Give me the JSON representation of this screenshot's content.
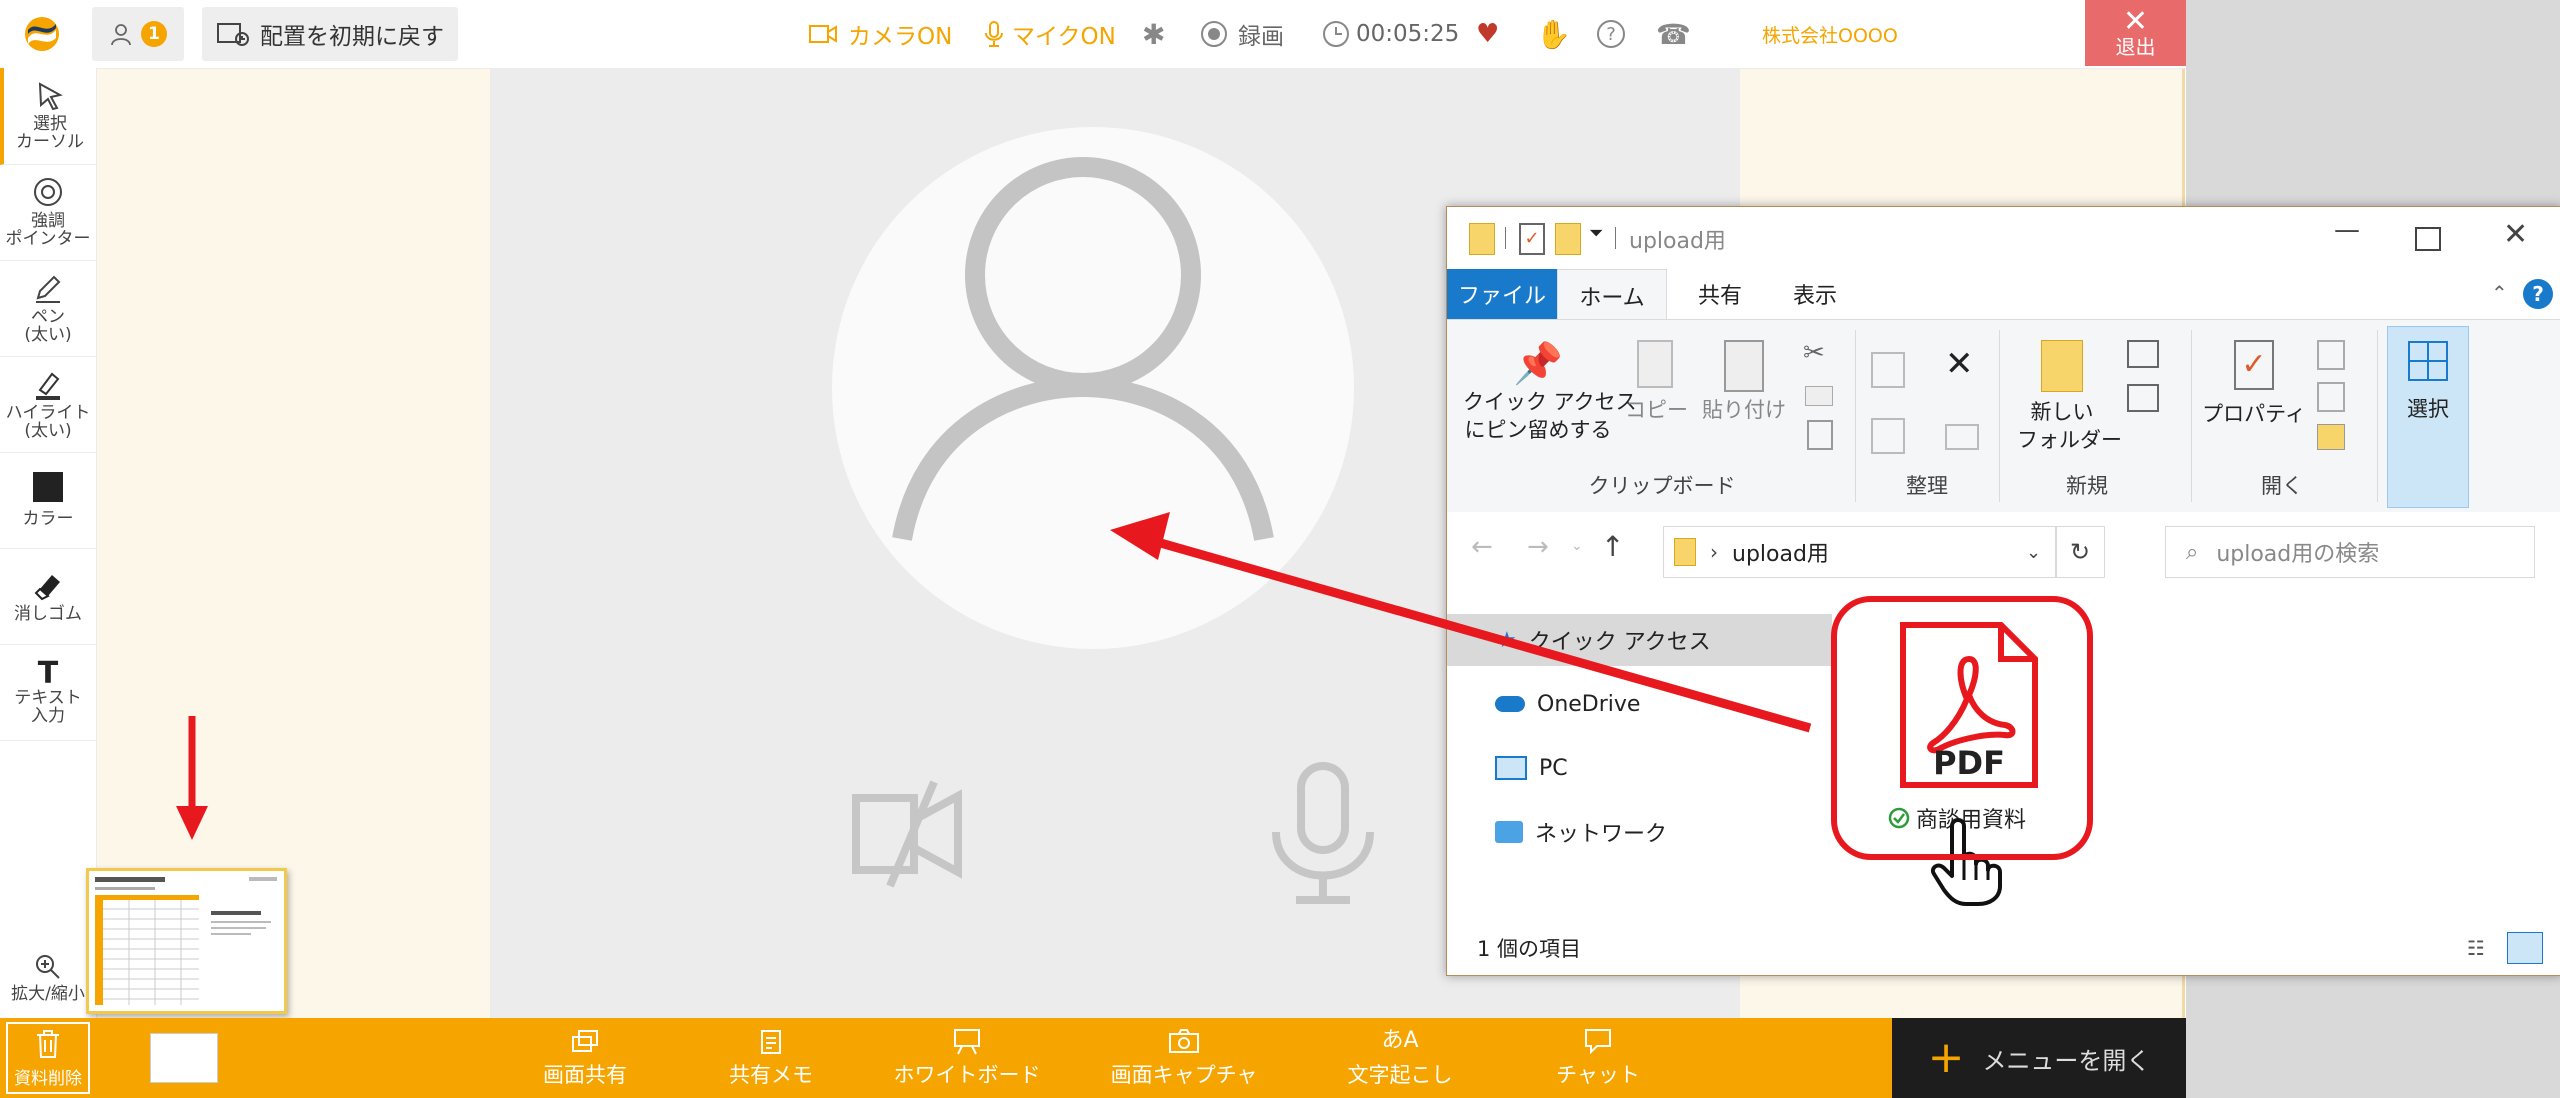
{
  "topbar": {
    "participant_count": "1",
    "reset_layout_label": "配置を初期に戻す",
    "camera_label": "カメラON",
    "mic_label": "マイクON",
    "record_label": "録画",
    "elapsed_time": "00:05:25",
    "company_name": "株式会社OOOO",
    "exit_label": "退出"
  },
  "left_tools": {
    "select_line1": "選択",
    "select_line2": "カーソル",
    "pointer_line1": "強調",
    "pointer_line2": "ポインター",
    "pen_line1": "ペン",
    "pen_line2": "(太い)",
    "highlight_line1": "ハイライト",
    "highlight_line2": "(太い)",
    "color_label": "カラー",
    "eraser_label": "消しゴム",
    "text_line1": "テキスト",
    "text_line2": "入力",
    "zoom_label": "拡大/縮小"
  },
  "bottombar": {
    "delete_label": "資料削除",
    "screen_share": "画面共有",
    "shared_memo": "共有メモ",
    "whiteboard": "ホワイトボード",
    "screen_capture": "画面キャプチャ",
    "transcription": "文字起こし",
    "chat": "チャット",
    "open_menu": "メニューを開く"
  },
  "explorer": {
    "title": "upload用",
    "tabs": [
      "ファイル",
      "ホーム",
      "共有",
      "表示"
    ],
    "ribbon": {
      "pin_line1": "クイック アクセス",
      "pin_line2": "にピン留めする",
      "copy": "コピー",
      "paste": "貼り付け",
      "new_folder_line1": "新しい",
      "new_folder_line2": "フォルダー",
      "properties": "プロパティ",
      "select": "選択",
      "group_clipboard": "クリップボード",
      "group_organize": "整理",
      "group_new": "新規",
      "group_open": "開く"
    },
    "address_path": "upload用",
    "search_placeholder": "upload用の検索",
    "nav": [
      "クイック アクセス",
      "OneDrive",
      "PC",
      "ネットワーク"
    ],
    "file_name": "商談用資料",
    "file_icon_text": "PDF",
    "status": "1 個の項目"
  },
  "colors": {
    "accent": "#f5a400",
    "exit": "#e96a6a",
    "annotation_red": "#e8191e",
    "explorer_file_tab": "#1979ca"
  }
}
